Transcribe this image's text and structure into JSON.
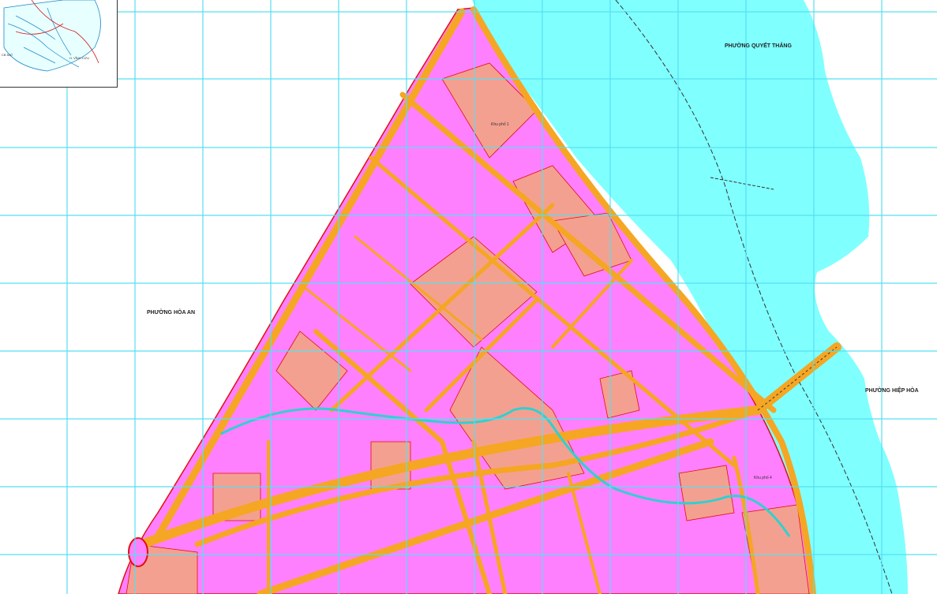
{
  "map": {
    "colors": {
      "river": "#80ffff",
      "residential": "#ff80ff",
      "public_land": "#f4a090",
      "road": "#f5a623",
      "grid": "#55e0f0",
      "boundary": "#e01010"
    },
    "place_labels": {
      "quyet_thang": "PHƯỜNG QUYẾT THẮNG",
      "hoa_an": "PHƯỜNG HÒA AN",
      "hiep_hoa": "PHƯỜNG HIỆP HÒA"
    },
    "small_labels": {
      "khu_pho_1": "Khu phố 1",
      "khu_pho_4": "Khu phố 4"
    },
    "inset": {
      "label_left": "CB NHĨ",
      "label_right": "H. VĨNH CỬU"
    }
  }
}
